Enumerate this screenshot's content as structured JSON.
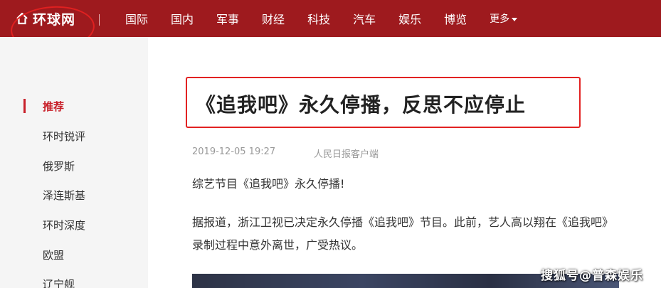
{
  "header": {
    "logo_text": "环球网",
    "nav_items": [
      "国际",
      "国内",
      "军事",
      "财经",
      "科技",
      "汽车",
      "娱乐",
      "博览"
    ],
    "more_label": "更多",
    "colors": {
      "bar": "#9e1a1e",
      "annotation": "#e02020"
    }
  },
  "sidebar": {
    "items": [
      {
        "label": "推荐",
        "active": true
      },
      {
        "label": "环时锐评"
      },
      {
        "label": "俄罗斯"
      },
      {
        "label": "泽连斯基"
      },
      {
        "label": "环时深度"
      },
      {
        "label": "欧盟"
      },
      {
        "label": "辽宁舰"
      }
    ],
    "accent": "#c8202a"
  },
  "article": {
    "title": "《追我吧》永久停播，反思不应停止",
    "datetime": "2019-12-05 19:27",
    "source": "人民日报客户端",
    "paragraphs": [
      "综艺节目《追我吧》永久停播!",
      "据报道，浙江卫视已决定永久停播《追我吧》节目。此前，艺人高以翔在《追我吧》录制过程中意外离世，广受热议。"
    ]
  },
  "watermark": "搜狐号@普森娱乐"
}
